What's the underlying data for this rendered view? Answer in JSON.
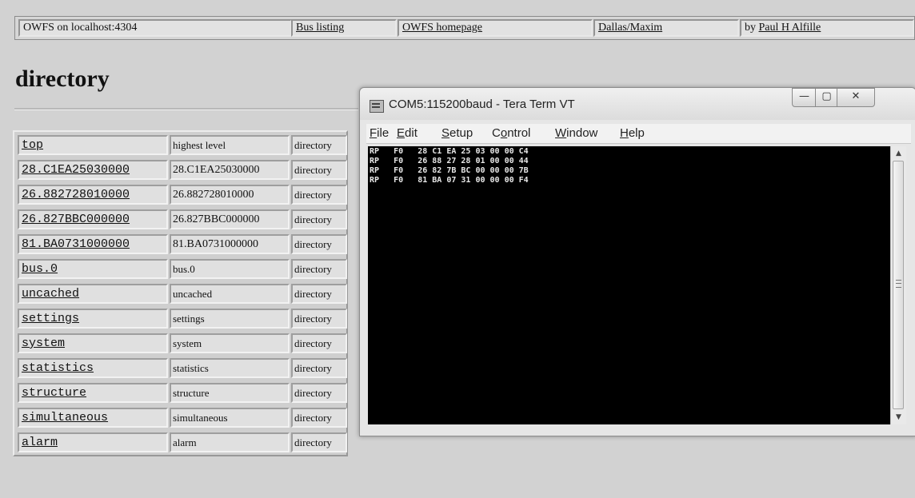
{
  "topbar": {
    "server": "OWFS on localhost:4304",
    "bus_listing": "Bus listing",
    "homepage": "OWFS homepage",
    "dallas": "Dallas/Maxim",
    "by_prefix": "by ",
    "author": "Paul H Alfille"
  },
  "page": {
    "title": "directory"
  },
  "directory": {
    "rows": [
      {
        "name": "top",
        "desc": "highest level",
        "type": "directory"
      },
      {
        "name": "28.C1EA25030000",
        "desc": "28.C1EA25030000",
        "type": "directory"
      },
      {
        "name": "26.882728010000",
        "desc": "26.882728010000",
        "type": "directory"
      },
      {
        "name": "26.827BBC000000",
        "desc": "26.827BBC000000",
        "type": "directory"
      },
      {
        "name": "81.BA0731000000",
        "desc": "81.BA0731000000",
        "type": "directory"
      },
      {
        "name": "bus.0",
        "desc": "bus.0",
        "type": "directory"
      },
      {
        "name": "uncached",
        "desc": "uncached",
        "type": "directory"
      },
      {
        "name": "settings",
        "desc": "settings",
        "type": "directory"
      },
      {
        "name": "system",
        "desc": "system",
        "type": "directory"
      },
      {
        "name": "statistics",
        "desc": "statistics",
        "type": "directory"
      },
      {
        "name": "structure",
        "desc": "structure",
        "type": "directory"
      },
      {
        "name": "simultaneous",
        "desc": "simultaneous",
        "type": "directory"
      },
      {
        "name": "alarm",
        "desc": "alarm",
        "type": "directory"
      }
    ]
  },
  "terminal": {
    "title": "COM5:115200baud - Tera Term VT",
    "icon": "tera-term-icon",
    "menu": {
      "file": {
        "u": "F",
        "rest": "ile"
      },
      "edit": {
        "u": "E",
        "rest": "dit"
      },
      "setup": {
        "u": "S",
        "rest": "etup"
      },
      "control": {
        "pre": "C",
        "u": "o",
        "rest": "ntrol"
      },
      "window": {
        "u": "W",
        "rest": "indow"
      },
      "help": {
        "u": "H",
        "rest": "elp"
      }
    },
    "buttons": {
      "minimize": "—",
      "maximize": "▢",
      "close": "✕"
    },
    "lines": [
      "RP   F0   28 C1 EA 25 03 00 00 C4",
      "RP   F0   26 88 27 28 01 00 00 44",
      "RP   F0   26 82 7B BC 00 00 00 7B",
      "RP   F0   81 BA 07 31 00 00 00 F4"
    ]
  }
}
